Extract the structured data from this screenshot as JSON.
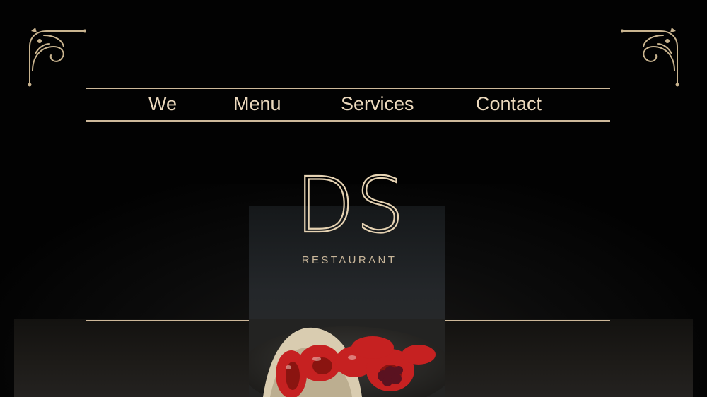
{
  "nav": {
    "items": [
      {
        "label": "We"
      },
      {
        "label": "Menu"
      },
      {
        "label": "Services"
      },
      {
        "label": "Contact"
      }
    ]
  },
  "brand": {
    "mark": "DS",
    "subtitle": "RESTAURANT"
  },
  "icons": {
    "corner_left": "ornament-corner-icon",
    "corner_right": "ornament-corner-icon"
  },
  "colors": {
    "background": "#020202",
    "gold": "#cdb89a",
    "text": "#ecd9bd",
    "strawberry": "#c62121"
  }
}
